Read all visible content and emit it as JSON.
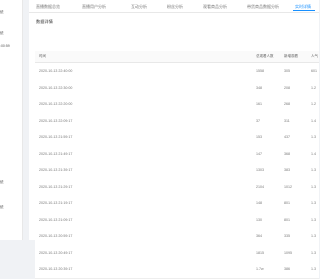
{
  "sidebar": {
    "items": [
      {
        "label": "统"
      },
      {
        "label": "统"
      },
      {
        "label": ":00:59"
      },
      {
        "label": "统"
      },
      {
        "label": "统"
      }
    ]
  },
  "tabs": [
    {
      "label": "直播数据总览"
    },
    {
      "label": "直播用户分析"
    },
    {
      "label": "互动分析"
    },
    {
      "label": "粉丝分析"
    },
    {
      "label": "观看商品分析"
    },
    {
      "label": "带货商品数据分析"
    },
    {
      "label": "实时详情"
    }
  ],
  "panel": {
    "title": "数据详情"
  },
  "table": {
    "headers": [
      "时间",
      "总观看人数",
      "新增观看",
      "人气"
    ],
    "rows": [
      {
        "time": "2020-10-13 22:40:00",
        "a": "1558",
        "b": "305",
        "c": "601"
      },
      {
        "time": "2020-10-13 22:30:00",
        "a": "348",
        "b": "208",
        "c": "1.2"
      },
      {
        "time": "2020-10-13 22:20:00",
        "a": "161",
        "b": "268",
        "c": "1.2"
      },
      {
        "time": "2020-10-13 22:09:17",
        "a": "37",
        "b": "311",
        "c": "1.4"
      },
      {
        "time": "2020-10-13 21:59:17",
        "a": "153",
        "b": "437",
        "c": "1.3"
      },
      {
        "time": "2020-10-13 21:49:17",
        "a": "147",
        "b": "368",
        "c": "1.4"
      },
      {
        "time": "2020-10-13 21:39:17",
        "a": "1303",
        "b": "383",
        "c": "1.3"
      },
      {
        "time": "2020-10-13 21:29:17",
        "a": "2104",
        "b": "1012",
        "c": "1.3"
      },
      {
        "time": "2020-10-13 21:19:17",
        "a": "148",
        "b": "801",
        "c": "1.3"
      },
      {
        "time": "2020-10-13 21:09:17",
        "a": "130",
        "b": "801",
        "c": "1.3"
      },
      {
        "time": "2020-10-13 20:59:17",
        "a": "364",
        "b": "335",
        "c": "1.3"
      },
      {
        "time": "2020-10-13 20:49:17",
        "a": "1815",
        "b": "1095",
        "c": "1.3"
      },
      {
        "time": "2020-10-13 20:39:17",
        "a": "1.7w",
        "b": "386",
        "c": "1.3"
      }
    ]
  },
  "colors": {
    "accent": "#1890ff",
    "background": "#f0f2f5"
  }
}
